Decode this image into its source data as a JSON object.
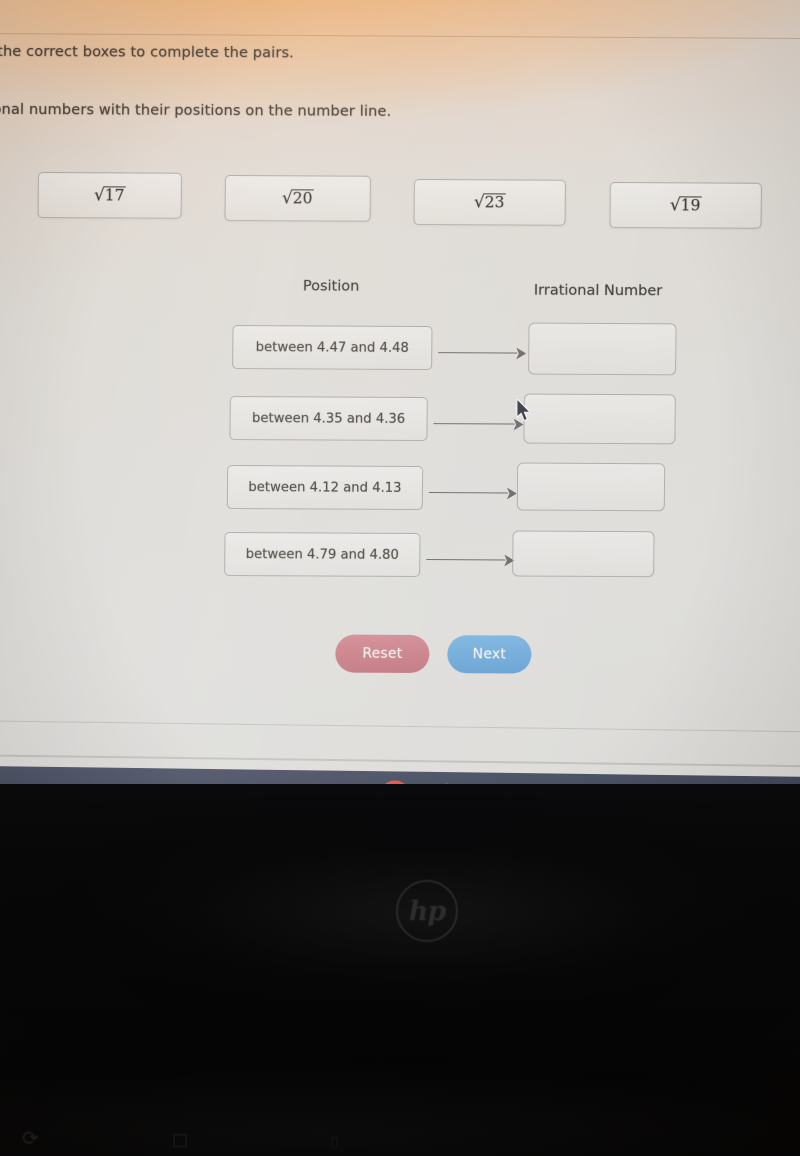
{
  "instructions": {
    "line1": "the correct boxes to complete the pairs.",
    "line2": "onal numbers with their positions on the number line."
  },
  "drag_tiles": [
    {
      "label": "√17",
      "radical": "√",
      "number": "17"
    },
    {
      "label": "√20",
      "radical": "√",
      "number": "20"
    },
    {
      "label": "√23",
      "radical": "√",
      "number": "23"
    },
    {
      "label": "√19",
      "radical": "√",
      "number": "19"
    }
  ],
  "headers": {
    "position": "Position",
    "irrational_number": "Irrational Number"
  },
  "rows": [
    {
      "position": "between 4.47 and 4.48",
      "answer": ""
    },
    {
      "position": "between 4.35 and 4.36",
      "answer": ""
    },
    {
      "position": "between 4.12 and 4.13",
      "answer": ""
    },
    {
      "position": "between 4.79 and 4.80",
      "answer": ""
    }
  ],
  "buttons": {
    "reset": "Reset",
    "next": "Next"
  },
  "taskbar": {
    "items": [
      {
        "name": "chrome-icon"
      },
      {
        "name": "weather-icon"
      }
    ]
  },
  "laptop": {
    "brand": "hp",
    "keys": [
      "⟳",
      "□",
      "⌷"
    ]
  },
  "colors": {
    "reset_button": "#c5757f",
    "next_button": "#66a4d6",
    "taskbar": "#343b50",
    "box_border": "#7d7b78",
    "text": "#3a342c"
  }
}
